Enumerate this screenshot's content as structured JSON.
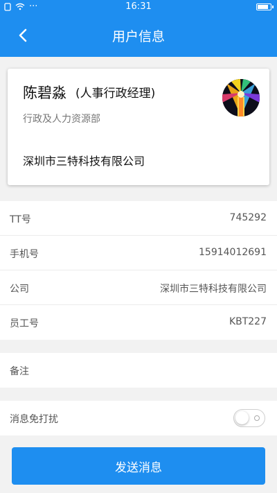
{
  "status_bar": {
    "time": "16:31",
    "dots": "···",
    "battery_level": 0.9
  },
  "header": {
    "title": "用户信息",
    "back_icon": "chevron-left-icon"
  },
  "profile": {
    "name": "陈碧淼",
    "role": "(人事行政经理)",
    "department": "行政及人力资源部",
    "company": "深圳市三特科技有限公司"
  },
  "details": {
    "rows": [
      {
        "label": "TT号",
        "value": "745292"
      },
      {
        "label": "手机号",
        "value": "15914012691"
      },
      {
        "label": "公司",
        "value": "深圳市三特科技有限公司"
      },
      {
        "label": "员工号",
        "value": "KBT227"
      }
    ]
  },
  "notes": {
    "label": "备注"
  },
  "dnd": {
    "label": "消息免打扰",
    "enabled": false
  },
  "actions": {
    "send_label": "发送消息"
  },
  "colors": {
    "primary": "#1e8ef0",
    "background": "#f2f2f2"
  }
}
